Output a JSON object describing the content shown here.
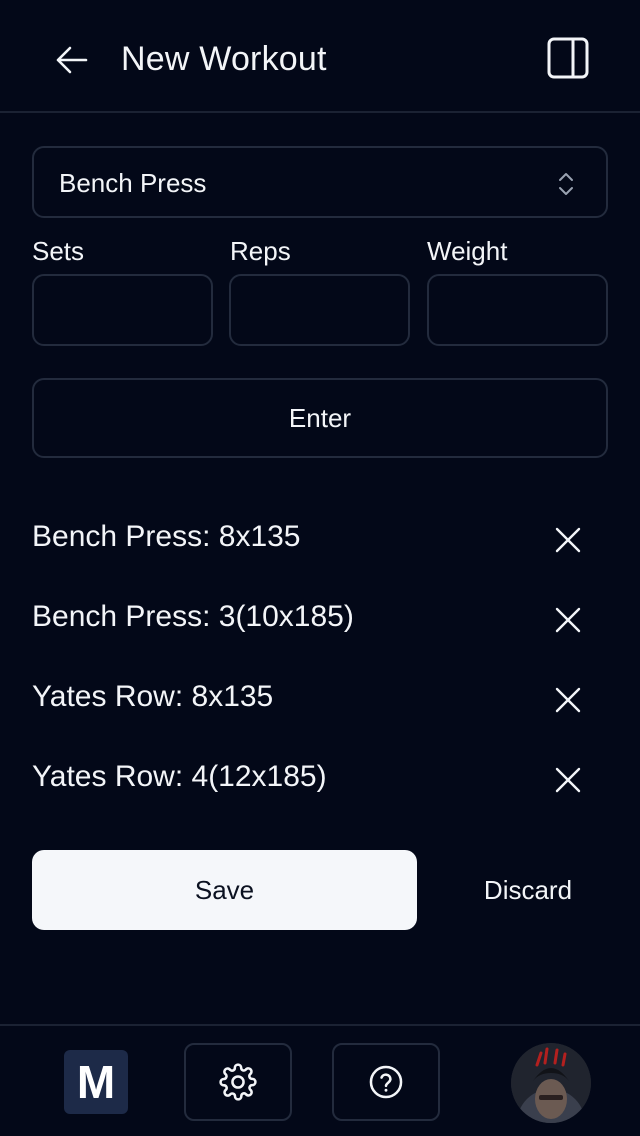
{
  "header": {
    "title": "New Workout",
    "back_icon": "arrow-left-icon",
    "sidebar_icon": "sidebar-toggle-icon"
  },
  "exercise_select": {
    "value": "Bench Press",
    "icon": "chevron-up-down-icon"
  },
  "fields": {
    "sets_label": "Sets",
    "reps_label": "Reps",
    "weight_label": "Weight",
    "sets_value": "",
    "reps_value": "",
    "weight_value": ""
  },
  "enter_label": "Enter",
  "log": [
    {
      "text": "Bench Press: 8x135"
    },
    {
      "text": "Bench Press: 3(10x185)"
    },
    {
      "text": "Yates Row: 8x135"
    },
    {
      "text": "Yates Row: 4(12x185)"
    }
  ],
  "actions": {
    "save_label": "Save",
    "discard_label": "Discard"
  },
  "bottom_nav": {
    "logo_letter": "M",
    "settings_icon": "gear-icon",
    "help_icon": "help-circle-icon",
    "avatar_icon": "user-avatar"
  },
  "colors": {
    "background": "#030818",
    "border": "#232b3d",
    "text": "#f3f5f8",
    "save_bg": "#f5f7fa",
    "logo_bg": "#1d2a48"
  }
}
